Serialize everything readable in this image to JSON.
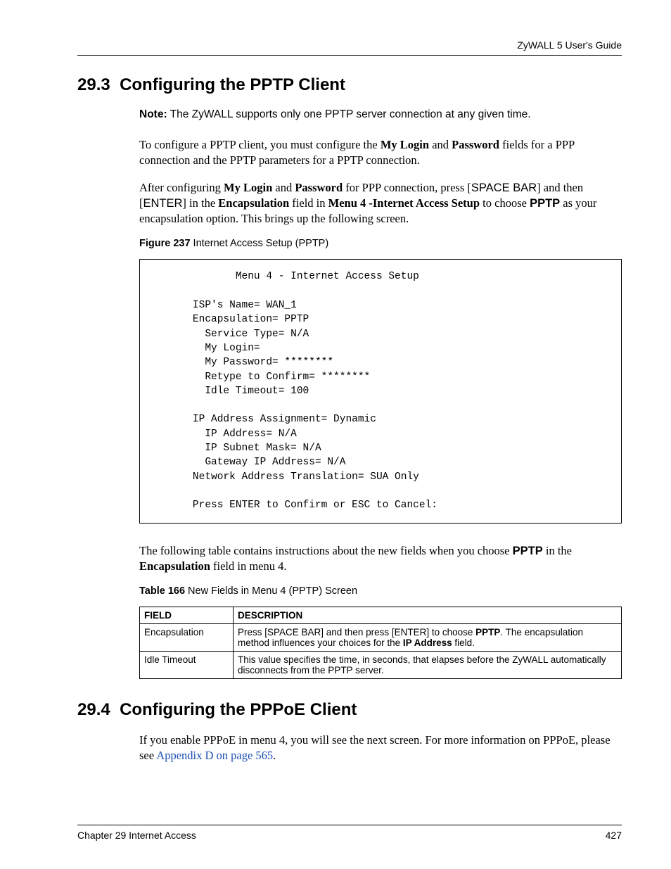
{
  "header": {
    "running_head": "ZyWALL 5 User's Guide"
  },
  "section1": {
    "number": "29.3",
    "title": "Configuring the PPTP Client",
    "note_label": "Note:",
    "note_text": " The ZyWALL supports only one PPTP server connection at any given time.",
    "p1_a": "To configure a PPTP client, you must configure the ",
    "p1_b": "My Login",
    "p1_c": " and ",
    "p1_d": "Password",
    "p1_e": " fields for a PPP connection and the PPTP parameters for a PPTP connection.",
    "p2_a": "After configuring ",
    "p2_b": "My Login",
    "p2_c": " and ",
    "p2_d": "Password",
    "p2_e": " for PPP connection, press [",
    "p2_f": "SPACE BAR",
    "p2_g": "] and then [",
    "p2_h": "ENTER",
    "p2_i": "] in the ",
    "p2_j": "Encapsulation",
    "p2_k": " field in ",
    "p2_l": "Menu 4 -Internet Access Setup",
    "p2_m": " to choose ",
    "p2_n": "PPTP",
    "p2_o": " as your encapsulation option. This brings up the following screen.",
    "figure_label": "Figure 237",
    "figure_caption": "   Internet Access Setup (PPTP)",
    "terminal": "              Menu 4 - Internet Access Setup\n\n       ISP's Name= WAN_1\n       Encapsulation= PPTP\n         Service Type= N/A\n         My Login=\n         My Password= ********\n         Retype to Confirm= ********\n         Idle Timeout= 100\n\n       IP Address Assignment= Dynamic\n         IP Address= N/A\n         IP Subnet Mask= N/A\n         Gateway IP Address= N/A\n       Network Address Translation= SUA Only\n\n       Press ENTER to Confirm or ESC to Cancel:",
    "p3_a": "The following table contains instructions about the new fields when you choose ",
    "p3_b": "PPTP",
    "p3_c": " in the ",
    "p3_d": "Encapsulation",
    "p3_e": " field in menu 4.",
    "table_label": "Table 166",
    "table_caption": "   New Fields in Menu 4 (PPTP) Screen",
    "table": {
      "h1": "FIELD",
      "h2": "DESCRIPTION",
      "rows": [
        {
          "field": "Encapsulation",
          "d_a": "Press [SPACE BAR] and then press [ENTER] to choose ",
          "d_b": "PPTP",
          "d_c": ". The encapsulation method influences your choices for the ",
          "d_d": "IP Address",
          "d_e": " field."
        },
        {
          "field": "Idle Timeout",
          "d_a": "This value specifies the time, in seconds, that elapses before the ZyWALL automatically disconnects from the PPTP server.",
          "d_b": "",
          "d_c": "",
          "d_d": "",
          "d_e": ""
        }
      ]
    }
  },
  "section2": {
    "number": "29.4",
    "title": "Configuring the PPPoE Client",
    "p1_a": "If you enable PPPoE in menu 4, you will see the next screen. For more information on PPPoE, please see ",
    "p1_link": "Appendix D on page 565",
    "p1_b": "."
  },
  "footer": {
    "chapter": "Chapter 29 Internet Access",
    "page": "427"
  }
}
